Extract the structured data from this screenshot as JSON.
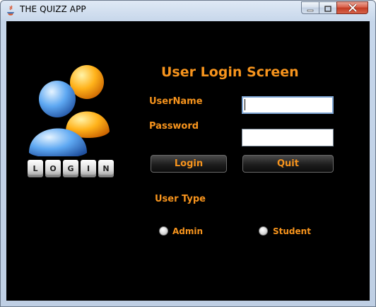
{
  "window": {
    "title": "THE QUIZZ APP",
    "controls": {
      "minimize": "minimize-icon",
      "maximize": "maximize-icon",
      "close": "close-icon"
    }
  },
  "form": {
    "heading": "User Login Screen",
    "username_label": "UserName",
    "username_value": "",
    "password_label": "Password",
    "password_value": "",
    "login_label": "Login",
    "quit_label": "Quit",
    "user_type_label": "User Type",
    "options": [
      "Admin",
      "Student"
    ]
  },
  "logo": {
    "letters": [
      "L",
      "O",
      "G",
      "I",
      "N"
    ],
    "icon": "users-login-icon"
  },
  "colors": {
    "accent": "#f7941d",
    "background": "#000000",
    "close_button": "#c94a32"
  }
}
